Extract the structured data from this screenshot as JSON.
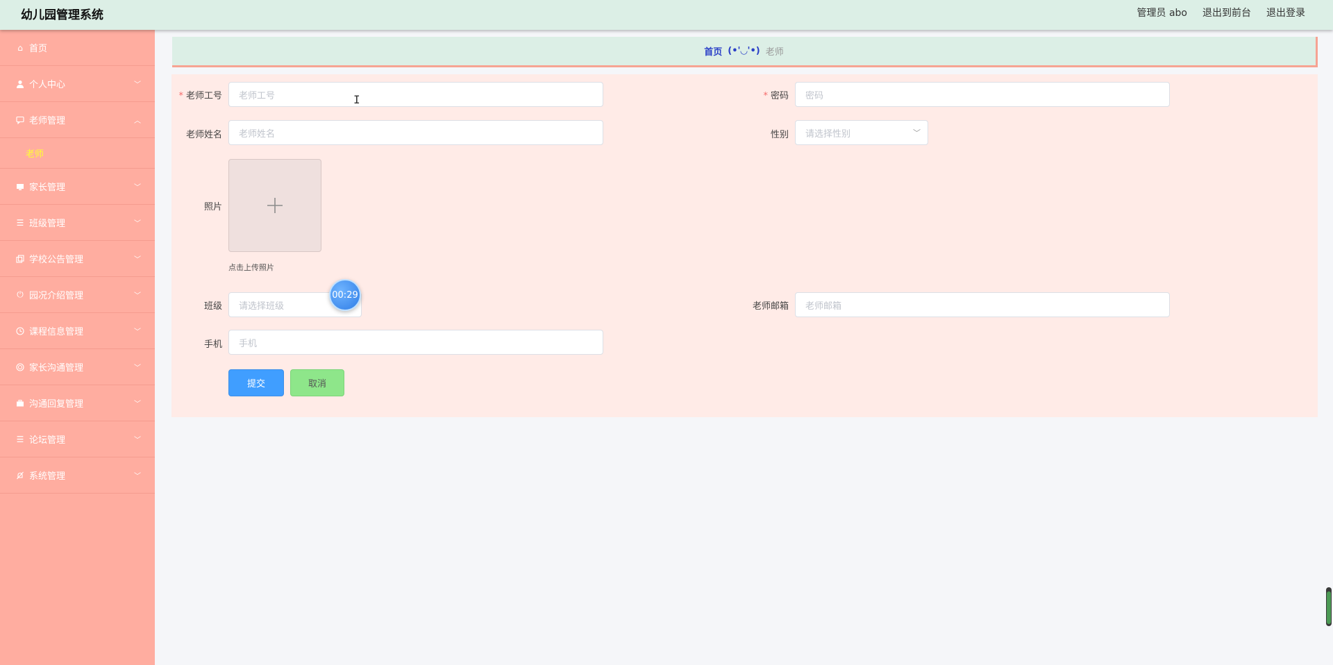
{
  "header": {
    "title": "幼儿园管理系统",
    "admin": "管理员 abo",
    "to_front": "退出到前台",
    "logout": "退出登录"
  },
  "sidebar": {
    "items": [
      {
        "label": "首页",
        "icon": "home-icon"
      },
      {
        "label": "个人中心",
        "icon": "user-icon"
      },
      {
        "label": "老师管理",
        "icon": "chat-icon",
        "expanded": true,
        "sub": [
          "老师"
        ]
      },
      {
        "label": "家长管理",
        "icon": "monitor-icon"
      },
      {
        "label": "班级管理",
        "icon": "list-icon"
      },
      {
        "label": "学校公告管理",
        "icon": "copy-icon"
      },
      {
        "label": "园况介绍管理",
        "icon": "power-icon"
      },
      {
        "label": "课程信息管理",
        "icon": "clock-icon"
      },
      {
        "label": "家长沟通管理",
        "icon": "globe-icon"
      },
      {
        "label": "沟通回复管理",
        "icon": "briefcase-icon"
      },
      {
        "label": "论坛管理",
        "icon": "list-icon"
      },
      {
        "label": "系统管理",
        "icon": "bell-off-icon"
      }
    ]
  },
  "breadcrumb": {
    "home": "首页",
    "face": "(•'◡'•)",
    "current": "老师"
  },
  "form": {
    "teacher_no_label": "老师工号",
    "teacher_no_placeholder": "老师工号",
    "password_label": "密码",
    "password_placeholder": "密码",
    "name_label": "老师姓名",
    "name_placeholder": "老师姓名",
    "gender_label": "性别",
    "gender_placeholder": "请选择性别",
    "photo_label": "照片",
    "photo_hint": "点击上传照片",
    "class_label": "班级",
    "class_placeholder": "请选择班级",
    "email_label": "老师邮箱",
    "email_placeholder": "老师邮箱",
    "phone_label": "手机",
    "phone_placeholder": "手机",
    "submit": "提交",
    "cancel": "取消"
  },
  "timer": "00:29",
  "colors": {
    "header_bg": "#dcefe6",
    "sidebar_bg": "#ffada0",
    "panel_bg": "#ffebe7",
    "submit_bg": "#409eff",
    "cancel_bg": "#8ee68a",
    "active_sub": "#ffff33"
  }
}
